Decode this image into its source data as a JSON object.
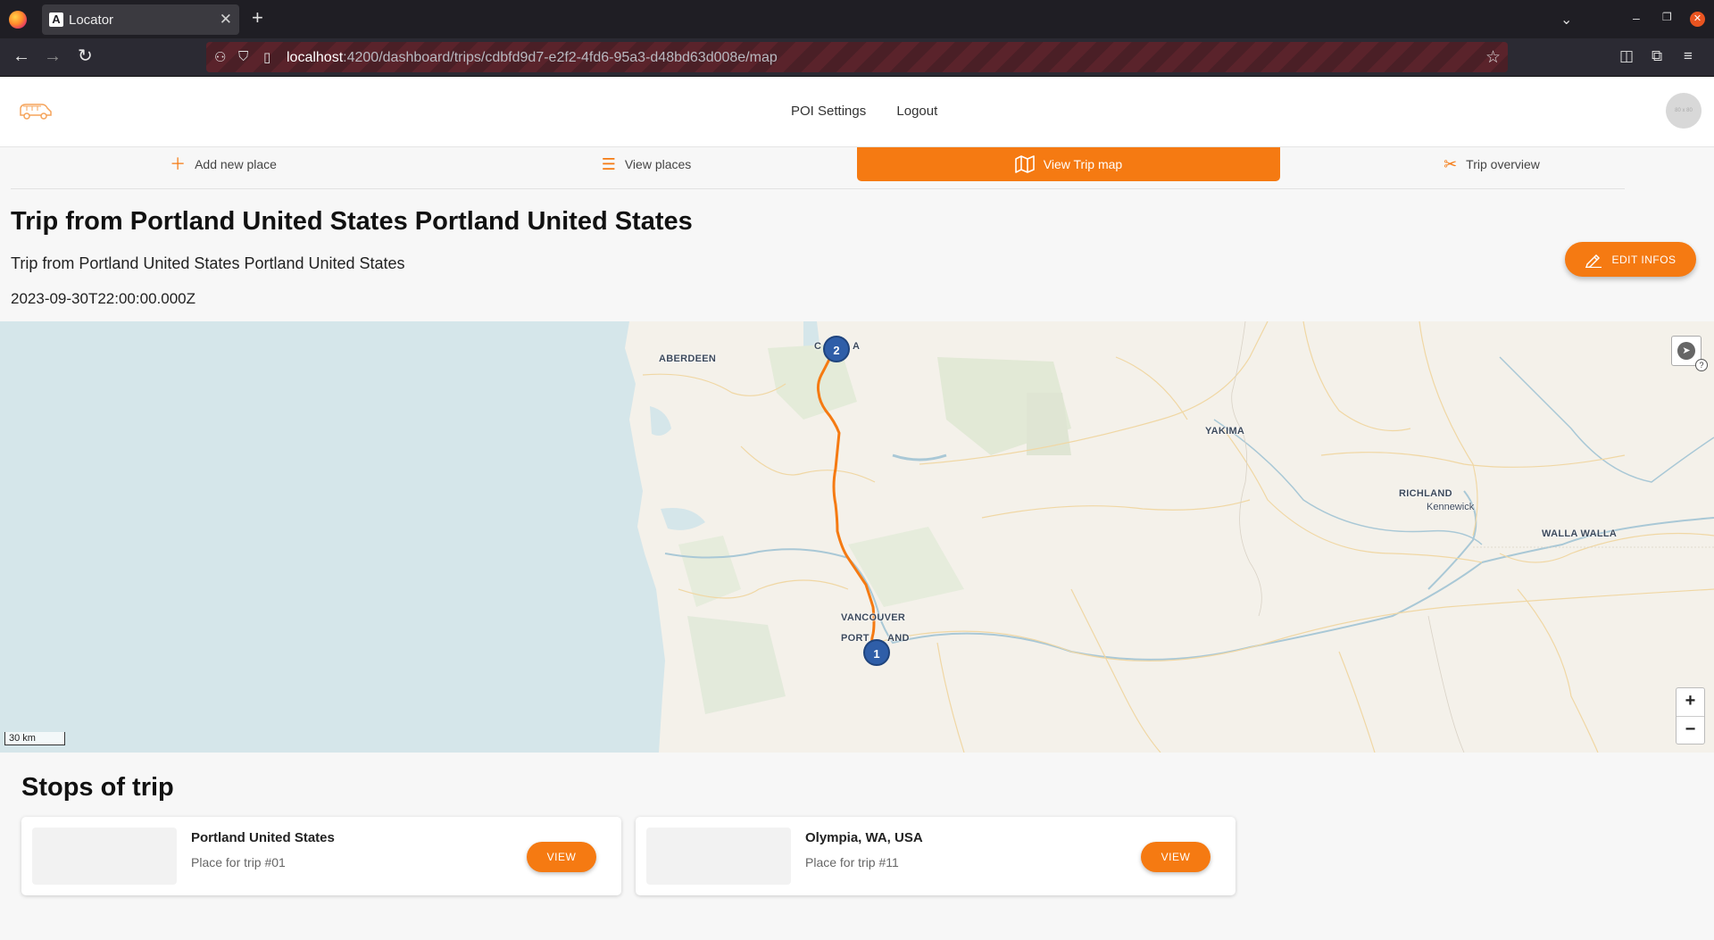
{
  "browser": {
    "tab_title": "Locator",
    "tab_favicon": "A",
    "url_host": "localhost",
    "url_path": ":4200/dashboard/trips/cdbfd9d7-e2f2-4fd6-95a3-d48bd63d008e/map"
  },
  "header": {
    "links": [
      "POI Settings",
      "Logout"
    ],
    "avatar_text": "80 x 80"
  },
  "subnav": {
    "tabs": [
      {
        "label": "Add new place",
        "icon": "plus-icon"
      },
      {
        "label": "View places",
        "icon": "list-icon"
      },
      {
        "label": "View Trip map",
        "icon": "map-icon",
        "active": true
      },
      {
        "label": "Trip overview",
        "icon": "tools-icon"
      }
    ]
  },
  "trip": {
    "title": "Trip from Portland United States Portland United States",
    "subtitle": "Trip from Portland United States Portland United States",
    "date": "2023-09-30T22:00:00.000Z",
    "edit_label": "EDIT INFOS"
  },
  "map": {
    "labels": {
      "aberdeen": "ABERDEEN",
      "olympia_a": "C",
      "olympia_b": "A",
      "yakima": "YAKIMA",
      "richland": "RICHLAND",
      "kennewick": "Kennewick",
      "walla_walla": "WALLA WALLA",
      "vancouver": "VANCOUVER",
      "portland_a": "PORT",
      "portland_b": "AND"
    },
    "markers": [
      "1",
      "2"
    ],
    "scale": "30 km",
    "zoom_in": "+",
    "zoom_out": "−",
    "route_color": "#f57a12"
  },
  "stops": {
    "title": "Stops of trip",
    "items": [
      {
        "name": "Portland United States",
        "description": "Place for trip #01",
        "button": "VIEW"
      },
      {
        "name": "Olympia, WA, USA",
        "description": "Place for trip #11",
        "button": "VIEW"
      }
    ]
  },
  "colors": {
    "accent": "#f57a12",
    "marker": "#2f5ea8",
    "ocean": "#d5e6ea"
  }
}
